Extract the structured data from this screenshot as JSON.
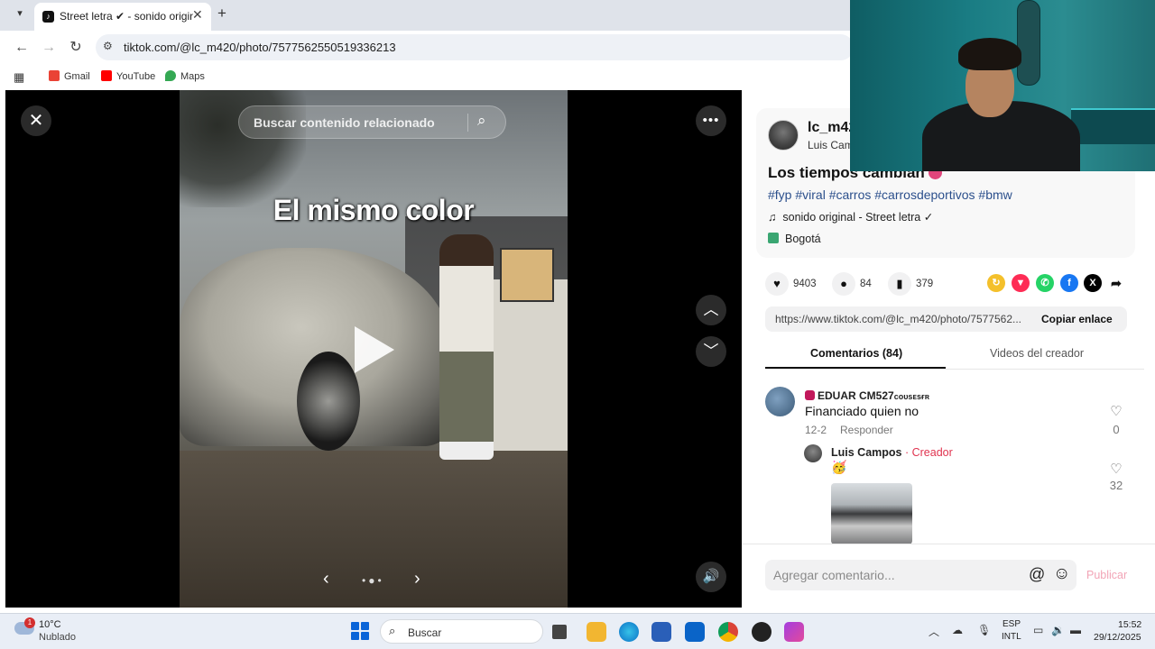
{
  "browser": {
    "tab_title": "Street letra ✔ - sonido original",
    "url": "tiktok.com/@lc_m420/photo/7577562550519336213",
    "bookmarks": [
      "Gmail",
      "YouTube",
      "Maps"
    ]
  },
  "viewer": {
    "search_placeholder": "Buscar contenido relacionado",
    "overlay_text": "El mismo color"
  },
  "post": {
    "username": "lc_m420",
    "display_name": "Luis Campos",
    "title": "Los tiempos cambian",
    "hashtags": "#fyp #viral #carros #carrosdeportivos #bmw",
    "sound": "sonido original - Street letra ✓",
    "location": "Bogotá",
    "likes": "9403",
    "comments": "84",
    "saves": "379",
    "link": "https://www.tiktok.com/@lc_m420/photo/7577562...",
    "copy_label": "Copiar enlace",
    "tab_comments": "Comentarios (84)",
    "tab_creator_videos": "Videos del creador"
  },
  "comments": [
    {
      "name": "EDUAR CM527",
      "name_suffix": "ᴄᴏᴜsᴇsғʀ",
      "text": "Financiado quien no",
      "date": "12-2",
      "reply_label": "Responder",
      "likes": "0"
    },
    {
      "name": "Luis Campos",
      "creator_label": "· Creador",
      "text": "🥳",
      "likes": "32"
    }
  ],
  "comment_box": {
    "placeholder": "Agregar comentario...",
    "publish_label": "Publicar"
  },
  "taskbar": {
    "weather_badge": "1",
    "temperature": "10°C",
    "condition": "Nublado",
    "search_label": "Buscar",
    "lang_line1": "ESP",
    "lang_line2": "INTL",
    "time": "15:52",
    "date": "29/12/2025"
  },
  "colors": {
    "hashtag": "#2b4f8c",
    "creator": "#e0334f",
    "publish_disabled": "#f2a4b6"
  }
}
